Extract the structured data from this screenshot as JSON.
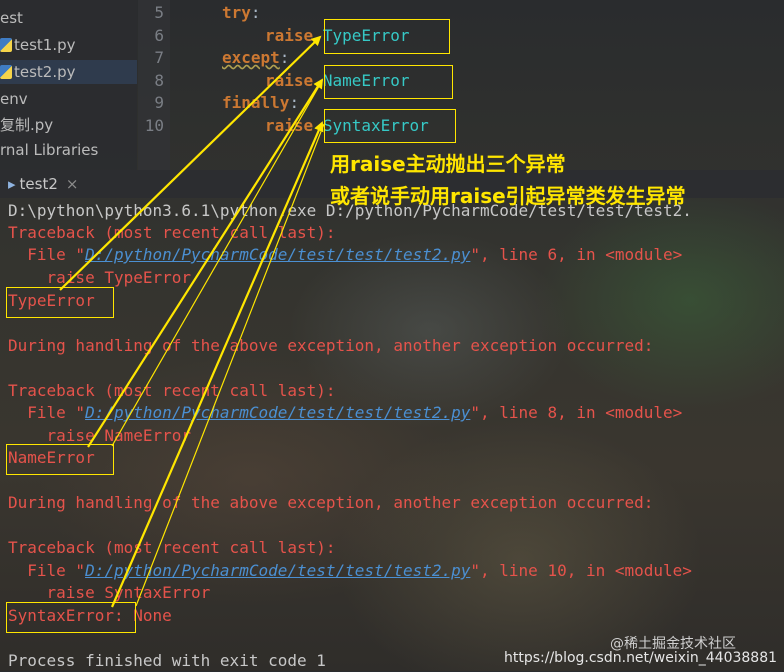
{
  "project_tree": {
    "items": [
      {
        "label": "est"
      },
      {
        "label": "test1.py"
      },
      {
        "label": "test2.py"
      },
      {
        "label": "env"
      },
      {
        "label": "复制.py"
      },
      {
        "label": "rnal Libraries"
      }
    ]
  },
  "editor": {
    "lines": [
      {
        "no": "5",
        "kw": "try",
        "rest": ":"
      },
      {
        "no": "6",
        "kw": "raise",
        "exc": "TypeError"
      },
      {
        "no": "7",
        "kw": "except",
        "rest": ":"
      },
      {
        "no": "8",
        "kw": "raise",
        "exc": "NameError"
      },
      {
        "no": "9",
        "kw": "finally",
        "rest": ":"
      },
      {
        "no": "10",
        "kw": "raise",
        "exc": "SyntaxError"
      }
    ]
  },
  "run_tab": {
    "label": "test2",
    "close": "×"
  },
  "console": {
    "cmd": "D:\\python\\python3.6.1\\python.exe D:/python/PycharmCode/test/test/test2.",
    "traceback_header": "Traceback (most recent call last):",
    "file_prefix": "  File \"",
    "file_path": "D:/python/PycharmCode/test/test/test2.py",
    "tb1_suffix": "\", line 6, in <module>",
    "tb1_code": "    raise TypeError",
    "err1": "TypeError",
    "during": "During handling of the above exception, another exception occurred:",
    "tb2_suffix": "\", line 8, in <module>",
    "tb2_code": "    raise NameError",
    "err2": "NameError",
    "tb3_suffix": "\", line 10, in <module>",
    "tb3_code": "    raise SyntaxError",
    "err3": "SyntaxError",
    "err3_rest": ": None",
    "finished": "Process finished with exit code 1"
  },
  "annotation": {
    "line1": "用raise主动抛出三个异常",
    "line2": "或者说手动用raise引起异常类发生异常"
  },
  "watermark": {
    "site": "@稀土掘金技术社区",
    "url": "https://blog.csdn.net/weixin_44038881"
  },
  "colors": {
    "highlight": "#ffe600",
    "error": "#e5534b",
    "keyword": "#cc7832",
    "link": "#4b8fd1"
  }
}
